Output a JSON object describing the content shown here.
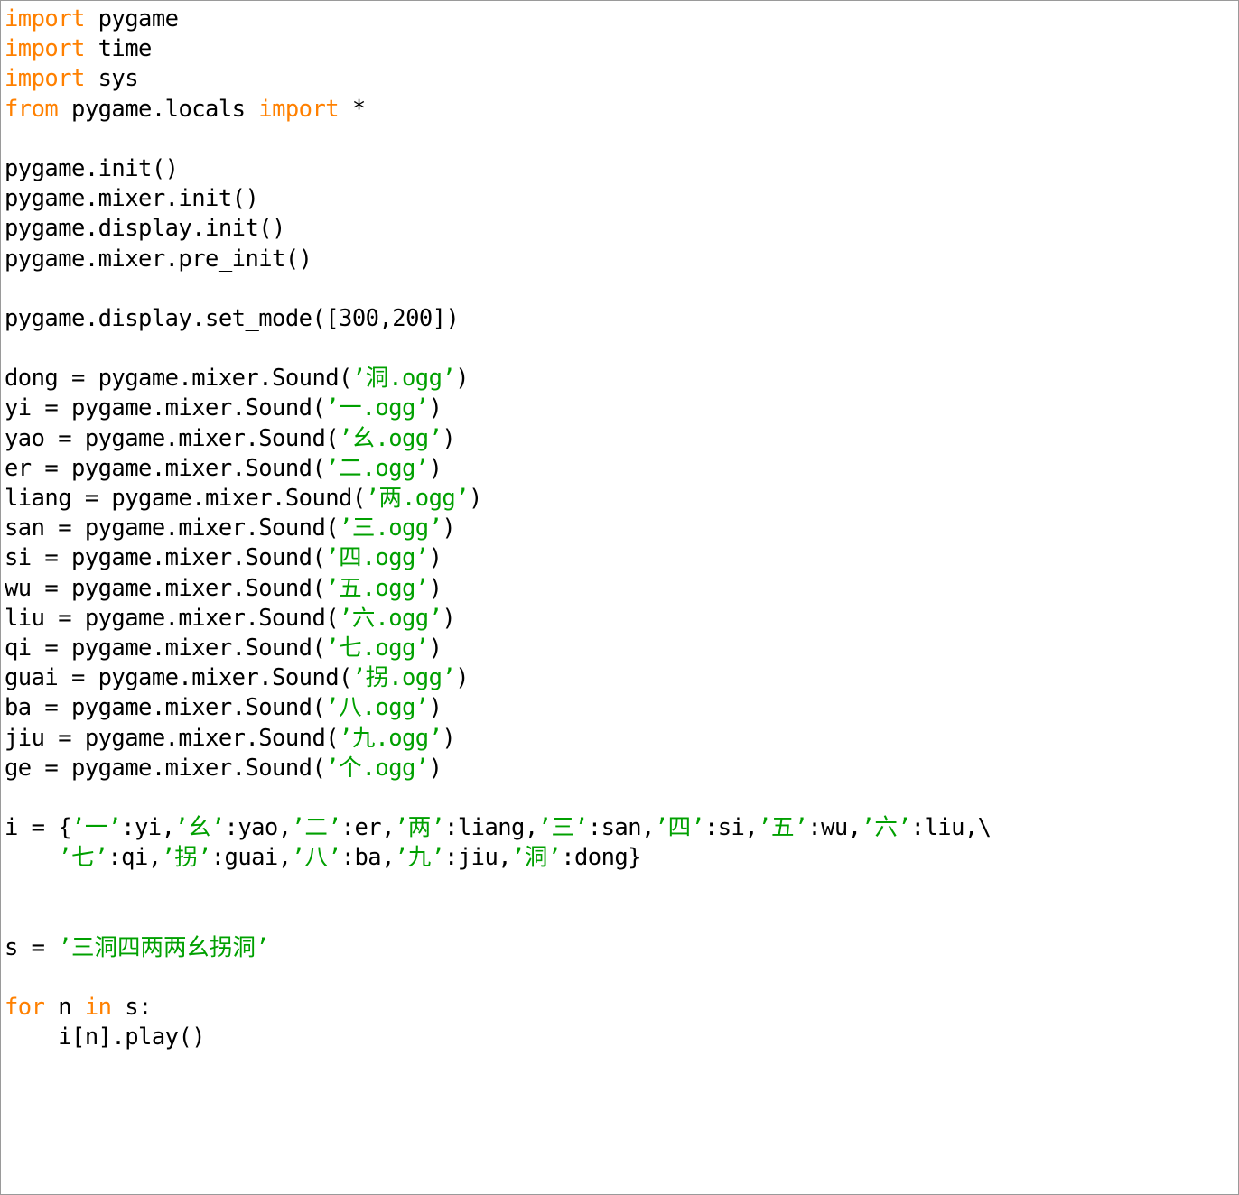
{
  "document": {
    "kind": "python-source-listing",
    "language": "Python",
    "background_color": "#ffffff",
    "border_color": "#9a9a9a",
    "colors": {
      "keyword": "#ff8000",
      "string": "#00a000",
      "default_text": "#000000"
    }
  },
  "code": {
    "lines": [
      {
        "id": "l1",
        "indent": 0,
        "tokens": [
          {
            "t": "kw",
            "v": "import"
          },
          {
            "t": "plain",
            "v": " pygame"
          }
        ]
      },
      {
        "id": "l2",
        "indent": 0,
        "tokens": [
          {
            "t": "kw",
            "v": "import"
          },
          {
            "t": "plain",
            "v": " time"
          }
        ]
      },
      {
        "id": "l3",
        "indent": 0,
        "tokens": [
          {
            "t": "kw",
            "v": "import"
          },
          {
            "t": "plain",
            "v": " sys"
          }
        ]
      },
      {
        "id": "l4",
        "indent": 0,
        "tokens": [
          {
            "t": "kw",
            "v": "from"
          },
          {
            "t": "plain",
            "v": " pygame.locals "
          },
          {
            "t": "kw",
            "v": "import"
          },
          {
            "t": "plain",
            "v": " *"
          }
        ]
      },
      {
        "id": "l5",
        "indent": 0,
        "tokens": []
      },
      {
        "id": "l6",
        "indent": 0,
        "tokens": [
          {
            "t": "plain",
            "v": "pygame.init()"
          }
        ]
      },
      {
        "id": "l7",
        "indent": 0,
        "tokens": [
          {
            "t": "plain",
            "v": "pygame.mixer.init()"
          }
        ]
      },
      {
        "id": "l8",
        "indent": 0,
        "tokens": [
          {
            "t": "plain",
            "v": "pygame.display.init()"
          }
        ]
      },
      {
        "id": "l9",
        "indent": 0,
        "tokens": [
          {
            "t": "plain",
            "v": "pygame.mixer.pre_init()"
          }
        ]
      },
      {
        "id": "l10",
        "indent": 0,
        "tokens": []
      },
      {
        "id": "l11",
        "indent": 0,
        "tokens": [
          {
            "t": "plain",
            "v": "pygame.display.set_mode([300,200])"
          }
        ]
      },
      {
        "id": "l12",
        "indent": 0,
        "tokens": []
      },
      {
        "id": "l13",
        "indent": 0,
        "tokens": [
          {
            "t": "plain",
            "v": "dong = pygame.mixer.Sound("
          },
          {
            "t": "str",
            "v": "’"
          },
          {
            "t": "cjk",
            "v": "洞"
          },
          {
            "t": "str",
            "v": ".ogg’"
          },
          {
            "t": "plain",
            "v": ")"
          }
        ]
      },
      {
        "id": "l14",
        "indent": 0,
        "tokens": [
          {
            "t": "plain",
            "v": "yi = pygame.mixer.Sound("
          },
          {
            "t": "str",
            "v": "’"
          },
          {
            "t": "cjk",
            "v": "一"
          },
          {
            "t": "str",
            "v": ".ogg’"
          },
          {
            "t": "plain",
            "v": ")"
          }
        ]
      },
      {
        "id": "l15",
        "indent": 0,
        "tokens": [
          {
            "t": "plain",
            "v": "yao = pygame.mixer.Sound("
          },
          {
            "t": "str",
            "v": "’"
          },
          {
            "t": "cjk",
            "v": "幺"
          },
          {
            "t": "str",
            "v": ".ogg’"
          },
          {
            "t": "plain",
            "v": ")"
          }
        ]
      },
      {
        "id": "l16",
        "indent": 0,
        "tokens": [
          {
            "t": "plain",
            "v": "er = pygame.mixer.Sound("
          },
          {
            "t": "str",
            "v": "’"
          },
          {
            "t": "cjk",
            "v": "二"
          },
          {
            "t": "str",
            "v": ".ogg’"
          },
          {
            "t": "plain",
            "v": ")"
          }
        ]
      },
      {
        "id": "l17",
        "indent": 0,
        "tokens": [
          {
            "t": "plain",
            "v": "liang = pygame.mixer.Sound("
          },
          {
            "t": "str",
            "v": "’"
          },
          {
            "t": "cjk",
            "v": "两"
          },
          {
            "t": "str",
            "v": ".ogg’"
          },
          {
            "t": "plain",
            "v": ")"
          }
        ]
      },
      {
        "id": "l18",
        "indent": 0,
        "tokens": [
          {
            "t": "plain",
            "v": "san = pygame.mixer.Sound("
          },
          {
            "t": "str",
            "v": "’"
          },
          {
            "t": "cjk",
            "v": "三"
          },
          {
            "t": "str",
            "v": ".ogg’"
          },
          {
            "t": "plain",
            "v": ")"
          }
        ]
      },
      {
        "id": "l19",
        "indent": 0,
        "tokens": [
          {
            "t": "plain",
            "v": "si = pygame.mixer.Sound("
          },
          {
            "t": "str",
            "v": "’"
          },
          {
            "t": "cjk",
            "v": "四"
          },
          {
            "t": "str",
            "v": ".ogg’"
          },
          {
            "t": "plain",
            "v": ")"
          }
        ]
      },
      {
        "id": "l20",
        "indent": 0,
        "tokens": [
          {
            "t": "plain",
            "v": "wu = pygame.mixer.Sound("
          },
          {
            "t": "str",
            "v": "’"
          },
          {
            "t": "cjk",
            "v": "五"
          },
          {
            "t": "str",
            "v": ".ogg’"
          },
          {
            "t": "plain",
            "v": ")"
          }
        ]
      },
      {
        "id": "l21",
        "indent": 0,
        "tokens": [
          {
            "t": "plain",
            "v": "liu = pygame.mixer.Sound("
          },
          {
            "t": "str",
            "v": "’"
          },
          {
            "t": "cjk",
            "v": "六"
          },
          {
            "t": "str",
            "v": ".ogg’"
          },
          {
            "t": "plain",
            "v": ")"
          }
        ]
      },
      {
        "id": "l22",
        "indent": 0,
        "tokens": [
          {
            "t": "plain",
            "v": "qi = pygame.mixer.Sound("
          },
          {
            "t": "str",
            "v": "’"
          },
          {
            "t": "cjk",
            "v": "七"
          },
          {
            "t": "str",
            "v": ".ogg’"
          },
          {
            "t": "plain",
            "v": ")"
          }
        ]
      },
      {
        "id": "l23",
        "indent": 0,
        "tokens": [
          {
            "t": "plain",
            "v": "guai = pygame.mixer.Sound("
          },
          {
            "t": "str",
            "v": "’"
          },
          {
            "t": "cjk",
            "v": "拐"
          },
          {
            "t": "str",
            "v": ".ogg’"
          },
          {
            "t": "plain",
            "v": ")"
          }
        ]
      },
      {
        "id": "l24",
        "indent": 0,
        "tokens": [
          {
            "t": "plain",
            "v": "ba = pygame.mixer.Sound("
          },
          {
            "t": "str",
            "v": "’"
          },
          {
            "t": "cjk",
            "v": "八"
          },
          {
            "t": "str",
            "v": ".ogg’"
          },
          {
            "t": "plain",
            "v": ")"
          }
        ]
      },
      {
        "id": "l25",
        "indent": 0,
        "tokens": [
          {
            "t": "plain",
            "v": "jiu = pygame.mixer.Sound("
          },
          {
            "t": "str",
            "v": "’"
          },
          {
            "t": "cjk",
            "v": "九"
          },
          {
            "t": "str",
            "v": ".ogg’"
          },
          {
            "t": "plain",
            "v": ")"
          }
        ]
      },
      {
        "id": "l26",
        "indent": 0,
        "tokens": [
          {
            "t": "plain",
            "v": "ge = pygame.mixer.Sound("
          },
          {
            "t": "str",
            "v": "’"
          },
          {
            "t": "cjk",
            "v": "个"
          },
          {
            "t": "str",
            "v": ".ogg’"
          },
          {
            "t": "plain",
            "v": ")"
          }
        ]
      },
      {
        "id": "l27",
        "indent": 0,
        "tokens": []
      },
      {
        "id": "l28",
        "indent": 0,
        "tokens": [
          {
            "t": "plain",
            "v": "i = {"
          },
          {
            "t": "str",
            "v": "’"
          },
          {
            "t": "cjk",
            "v": "一"
          },
          {
            "t": "str",
            "v": "’"
          },
          {
            "t": "plain",
            "v": ":yi,"
          },
          {
            "t": "str",
            "v": "’"
          },
          {
            "t": "cjk",
            "v": "幺"
          },
          {
            "t": "str",
            "v": "’"
          },
          {
            "t": "plain",
            "v": ":yao,"
          },
          {
            "t": "str",
            "v": "’"
          },
          {
            "t": "cjk",
            "v": "二"
          },
          {
            "t": "str",
            "v": "’"
          },
          {
            "t": "plain",
            "v": ":er,"
          },
          {
            "t": "str",
            "v": "’"
          },
          {
            "t": "cjk",
            "v": "两"
          },
          {
            "t": "str",
            "v": "’"
          },
          {
            "t": "plain",
            "v": ":liang,"
          },
          {
            "t": "str",
            "v": "’"
          },
          {
            "t": "cjk",
            "v": "三"
          },
          {
            "t": "str",
            "v": "’"
          },
          {
            "t": "plain",
            "v": ":san,"
          },
          {
            "t": "str",
            "v": "’"
          },
          {
            "t": "cjk",
            "v": "四"
          },
          {
            "t": "str",
            "v": "’"
          },
          {
            "t": "plain",
            "v": ":si,"
          },
          {
            "t": "str",
            "v": "’"
          },
          {
            "t": "cjk",
            "v": "五"
          },
          {
            "t": "str",
            "v": "’"
          },
          {
            "t": "plain",
            "v": ":wu,"
          },
          {
            "t": "str",
            "v": "’"
          },
          {
            "t": "cjk",
            "v": "六"
          },
          {
            "t": "str",
            "v": "’"
          },
          {
            "t": "plain",
            "v": ":liu,\\"
          }
        ]
      },
      {
        "id": "l29",
        "indent": 4,
        "tokens": [
          {
            "t": "str",
            "v": "’"
          },
          {
            "t": "cjk",
            "v": "七"
          },
          {
            "t": "str",
            "v": "’"
          },
          {
            "t": "plain",
            "v": ":qi,"
          },
          {
            "t": "str",
            "v": "’"
          },
          {
            "t": "cjk",
            "v": "拐"
          },
          {
            "t": "str",
            "v": "’"
          },
          {
            "t": "plain",
            "v": ":guai,"
          },
          {
            "t": "str",
            "v": "’"
          },
          {
            "t": "cjk",
            "v": "八"
          },
          {
            "t": "str",
            "v": "’"
          },
          {
            "t": "plain",
            "v": ":ba,"
          },
          {
            "t": "str",
            "v": "’"
          },
          {
            "t": "cjk",
            "v": "九"
          },
          {
            "t": "str",
            "v": "’"
          },
          {
            "t": "plain",
            "v": ":jiu,"
          },
          {
            "t": "str",
            "v": "’"
          },
          {
            "t": "cjk",
            "v": "洞"
          },
          {
            "t": "str",
            "v": "’"
          },
          {
            "t": "plain",
            "v": ":dong}"
          }
        ]
      },
      {
        "id": "l30",
        "indent": 0,
        "tokens": []
      },
      {
        "id": "l31",
        "indent": 0,
        "tokens": []
      },
      {
        "id": "l32",
        "indent": 0,
        "tokens": [
          {
            "t": "plain",
            "v": "s = "
          },
          {
            "t": "str",
            "v": "’"
          },
          {
            "t": "cjk",
            "v": "三洞四两两幺拐洞"
          },
          {
            "t": "str",
            "v": "’"
          }
        ]
      },
      {
        "id": "l33",
        "indent": 0,
        "tokens": []
      },
      {
        "id": "l34",
        "indent": 0,
        "tokens": [
          {
            "t": "kw",
            "v": "for"
          },
          {
            "t": "plain",
            "v": " n "
          },
          {
            "t": "kw",
            "v": "in"
          },
          {
            "t": "plain",
            "v": " s:"
          }
        ]
      },
      {
        "id": "l35",
        "indent": 4,
        "tokens": [
          {
            "t": "plain",
            "v": "i[n].play()"
          }
        ]
      }
    ],
    "plain_text": "import pygame\nimport time\nimport sys\nfrom pygame.locals import *\n\npygame.init()\npygame.mixer.init()\npygame.display.init()\npygame.mixer.pre_init()\n\npygame.display.set_mode([300,200])\n\ndong = pygame.mixer.Sound('洞.ogg')\nyi = pygame.mixer.Sound('一.ogg')\nyao = pygame.mixer.Sound('幺.ogg')\ner = pygame.mixer.Sound('二.ogg')\nliang = pygame.mixer.Sound('两.ogg')\nsan = pygame.mixer.Sound('三.ogg')\nsi = pygame.mixer.Sound('四.ogg')\nwu = pygame.mixer.Sound('五.ogg')\nliu = pygame.mixer.Sound('六.ogg')\nqi = pygame.mixer.Sound('七.ogg')\nguai = pygame.mixer.Sound('拐.ogg')\nba = pygame.mixer.Sound('八.ogg')\njiu = pygame.mixer.Sound('九.ogg')\nge = pygame.mixer.Sound('个.ogg')\n\ni = {'一':yi,'幺':yao,'二':er,'两':liang,'三':san,'四':si,'五':wu,'六':liu,\\\n    '七':qi,'拐':guai,'八':ba,'九':jiu,'洞':dong}\n\n\ns = '三洞四两两幺拐洞'\n\nfor n in s:\n    i[n].play()"
  }
}
